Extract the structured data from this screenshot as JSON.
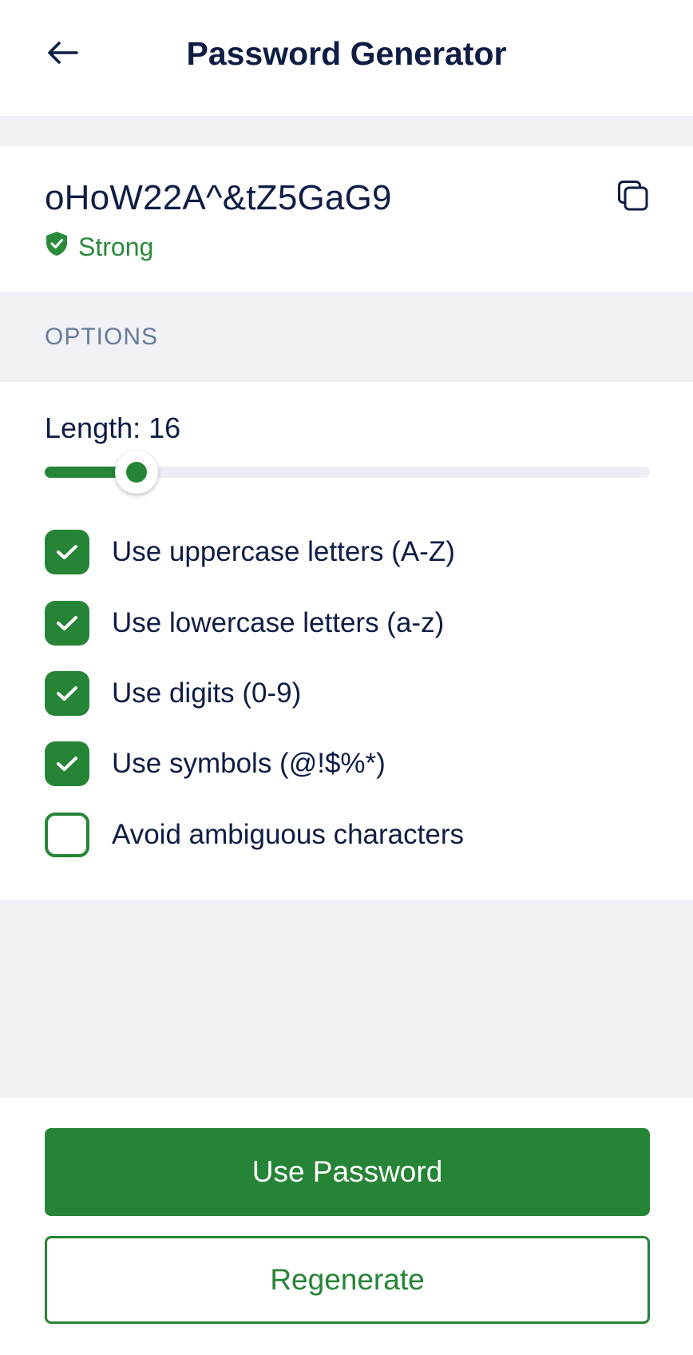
{
  "header": {
    "title": "Password Generator",
    "back_icon": "arrow-left-icon"
  },
  "password": {
    "value": "oHoW22A^&tZ5GaG9",
    "strength_label": "Strong",
    "strength_icon": "shield-check-icon",
    "copy_icon": "copy-icon"
  },
  "options": {
    "section_label": "OPTIONS",
    "length_label": "Length: 16",
    "length_value": 16,
    "length_min": 8,
    "length_max": 64,
    "items": [
      {
        "label": "Use uppercase letters (A-Z)",
        "checked": true
      },
      {
        "label": "Use lowercase letters (a-z)",
        "checked": true
      },
      {
        "label": "Use digits (0-9)",
        "checked": true
      },
      {
        "label": "Use symbols (@!$%*)",
        "checked": true
      },
      {
        "label": "Avoid ambiguous characters",
        "checked": false
      }
    ]
  },
  "actions": {
    "use_label": "Use Password",
    "regenerate_label": "Regenerate"
  },
  "colors": {
    "accent": "#268436",
    "text": "#0f1d45",
    "muted": "#6b7a99",
    "band": "#eff1f5"
  }
}
